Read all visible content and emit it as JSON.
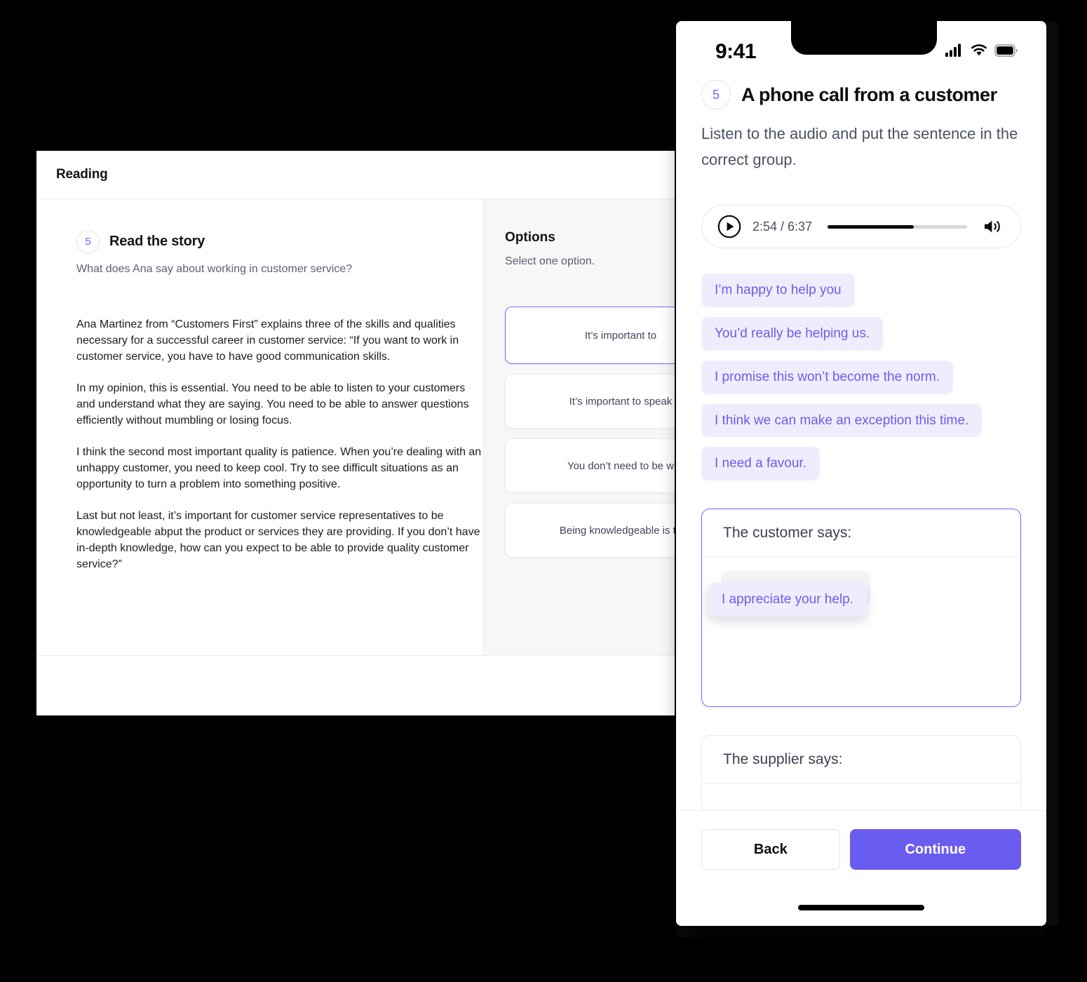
{
  "desktop": {
    "window_title": "Reading",
    "question": {
      "number": "5",
      "title": "Read the story",
      "subtitle": "What does Ana say about working in customer service?"
    },
    "story_paragraphs": [
      "Ana Martinez from “Customers First” explains three of the skills and qualities necessary for a successful career in customer service: “If you want to work in customer service, you have to have good communication skills.",
      "In my opinion, this is essential. You need to be able to listen to your customers and understand what they are saying. You need to be able to answer questions efficiently without mumbling or losing focus.",
      "I think the second most important quality is patience. When you’re dealing with an unhappy customer, you need to keep cool. Try to see difficult situations as an opportunity to turn a problem into something positive.",
      "Last but not least, it’s important for customer service representatives to be knowledgeable abput the product or services they are providing. If you don’t have in-depth knowledge, how can you expect to be  able to provide quality customer service?”"
    ],
    "options_panel": {
      "title": "Options",
      "subtitle": "Select one option.",
      "options": [
        {
          "label": "It’s important to",
          "selected": true
        },
        {
          "label": "It’s important to speak",
          "selected": false
        },
        {
          "label": "You don’t need to be w",
          "selected": false
        },
        {
          "label": "Being knowledgeable is th",
          "selected": false
        }
      ]
    }
  },
  "phone": {
    "status_bar": {
      "time": "9:41",
      "cellular_icon": "signal-bars-icon",
      "wifi_icon": "wifi-icon",
      "battery_icon": "battery-icon"
    },
    "header": {
      "number": "5",
      "title": "A phone call from a customer",
      "instruction": "Listen to the audio and put the sentence in the correct group."
    },
    "audio": {
      "play_icon": "play-circle-icon",
      "current_time": "2:54",
      "separator": "/",
      "total_time": "6:37",
      "time_display": "2:54 / 6:37",
      "progress_percent": 62,
      "volume_icon": "volume-icon"
    },
    "sentence_chips": [
      "I’m happy to help you",
      "You’d really be helping us.",
      "I promise this won’t become the norm.",
      "I think we can make an exception this time.",
      "I need a favour."
    ],
    "dropzones": [
      {
        "label": "The customer says:",
        "active": true,
        "dragged_chip": "I appreciate your help."
      },
      {
        "label": "The supplier says:",
        "active": false,
        "dragged_chip": null
      }
    ],
    "footer": {
      "back_label": "Back",
      "continue_label": "Continue"
    }
  },
  "colors": {
    "accent_purple": "#6b5cf0",
    "chip_bg": "#efedfd",
    "badge_purple": "#7b61ff",
    "panel_gray": "#f7f7f8",
    "text_dark": "#0d0d14",
    "text_muted": "#4c5263"
  }
}
